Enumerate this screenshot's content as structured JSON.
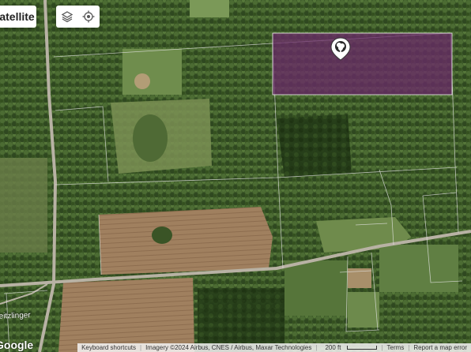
{
  "map": {
    "type_label": "Satellite",
    "road_label": "Seitzlinger",
    "google_logo": "Google"
  },
  "controls": {
    "layers_icon": "layers-icon",
    "locate_icon": "my-location-icon"
  },
  "attribution": {
    "keyboard": "Keyboard shortcuts",
    "imagery": "Imagery ©2024 Airbus, CNES / Airbus, Maxar Technologies",
    "scale": "200 ft",
    "terms": "Terms",
    "report": "Report a map error"
  },
  "parcel": {
    "color": "#6b2a6a",
    "icon": "tree-marker-icon"
  },
  "colors": {
    "forest": "#3e5b2a",
    "field": "#9a7a5c",
    "meadow": "#6b8a4b",
    "road": "#b7b1a3"
  }
}
